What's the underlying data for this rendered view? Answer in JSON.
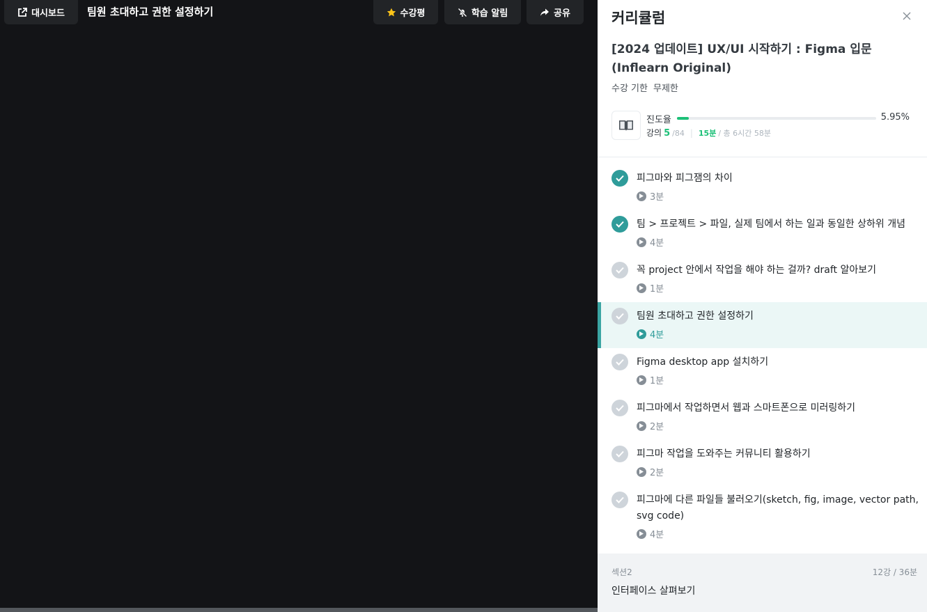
{
  "player": {
    "dashboard_label": "대시보드",
    "lesson_title": "팀원 초대하고 권한 설정하기",
    "review_label": "수강평",
    "alarm_label": "학습 알림",
    "share_label": "공유"
  },
  "panel": {
    "title": "커리큘럼",
    "course_title": "[2024 업데이트] UX/UI 시작하기 : Figma 입문 (Inflearn Original)",
    "period_label": "수강 기한",
    "period_value": "무제한",
    "progress_label": "진도율",
    "progress_fraction": 0.0595,
    "progress_percent": "5.95%",
    "lecture_label": "강의",
    "lectures_done": "5",
    "lectures_total": "/84",
    "time_done": "15분",
    "time_total": "/ 총 6시간 58분"
  },
  "items": [
    {
      "title": "피그마와 피그잼의 차이",
      "duration": "3분",
      "status": "done"
    },
    {
      "title": "팀 > 프로젝트 > 파일, 실제 팀에서 하는 일과 동일한 상하위 개념",
      "duration": "4분",
      "status": "done"
    },
    {
      "title": "꼭 project 안에서 작업을 해야 하는 걸까? draft 알아보기",
      "duration": "1분",
      "status": "todo"
    },
    {
      "title": "팀원 초대하고 권한 설정하기",
      "duration": "4분",
      "status": "active"
    },
    {
      "title": "Figma desktop app 설치하기",
      "duration": "1분",
      "status": "todo"
    },
    {
      "title": "피그마에서 작업하면서 웹과 스마트폰으로 미러링하기",
      "duration": "2분",
      "status": "todo"
    },
    {
      "title": "피그마 작업을 도와주는 커뮤니티 활용하기",
      "duration": "2분",
      "status": "todo"
    },
    {
      "title": "피그마에 다른 파일들 불러오기(sketch, fig, image, vector path, svg code)",
      "duration": "4분",
      "status": "todo"
    }
  ],
  "section": {
    "label": "섹션2",
    "count": "12강 / 36분",
    "name": "인터페이스 살펴보기"
  },
  "colors": {
    "accent": "#1dc078",
    "teal": "#2f9c9a",
    "active_bg": "#ebf7f6"
  }
}
